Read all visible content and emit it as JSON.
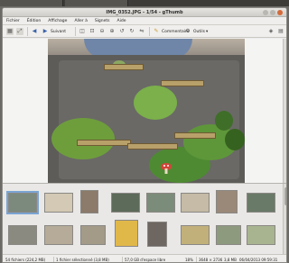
{
  "window": {
    "title": "IMG_0352.JPG - 1/54 - gThumb"
  },
  "menu": [
    "Fichier",
    "Édition",
    "Affichage",
    "Aller à",
    "Signets",
    "Aide"
  ],
  "toolbar": {
    "next_label": "Suivant",
    "comments_label": "Commentaire",
    "tools_label": "Outils"
  },
  "status": {
    "files": "54 fichiers (224,2 MB)",
    "selected": "1 fichier sélectionné (3,8 MB)",
    "free_space": "57,0 GB d'espace libre",
    "zoom": "18%",
    "dimensions": "3648 × 2736",
    "size": "3,8 MB",
    "date": "06/04/2013 09:59:31"
  },
  "colors": {
    "selection": "#7aa4d4",
    "close_button": "#d46a3a"
  }
}
